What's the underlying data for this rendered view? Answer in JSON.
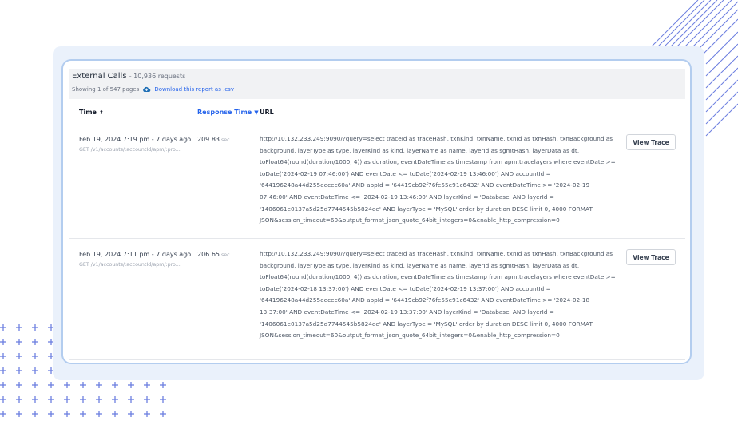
{
  "header": {
    "title": "External Calls",
    "count": "- 10,936 requests",
    "showing": "Showing 1 of 547 pages",
    "download_label": "Download this report as .csv",
    "download_icon": "cloud-download-icon"
  },
  "columns": {
    "time": "Time",
    "response_time": "Response Time",
    "url": "URL"
  },
  "rows": [
    {
      "time": "Feb 19, 2024 7:19 pm - 7 days ago",
      "endpoint": "GET /v1/accounts/:accountId/apm/:pro...",
      "response": "209.83",
      "unit": "sec",
      "url": "http://10.132.233.249:9090/?query=select traceId as traceHash, txnKind, txnName, txnId as txnHash, txnBackground as background, layerType as type, layerKind as kind, layerName as name, layerId as sgmtHash, layerData as dt, toFloat64(round(duration/1000, 4)) as duration, eventDateTime as timestamp from apm.tracelayers where eventDate >= toDate('2024-02-19 07:46:00') AND eventDate <= toDate('2024-02-19 13:46:00') AND accountId = '644196248a44d255eecec60a' AND appId = '64419cb92f76fe55e91c6432' AND eventDateTime >= '2024-02-19 07:46:00' AND eventDateTime <= '2024-02-19 13:46:00' AND layerKind = 'Database' AND layerId = '1406061e0137a5d25d7744545b5824ee' AND layerType = 'MySQL' order by duration DESC limit 0, 4000 FORMAT JSON&session_timeout=60&output_format_json_quote_64bit_integers=0&enable_http_compression=0",
      "button": "View Trace"
    },
    {
      "time": "Feb 19, 2024 7:11 pm - 7 days ago",
      "endpoint": "GET /v1/accounts/:accountId/apm/:pro...",
      "response": "206.65",
      "unit": "sec",
      "url": "http://10.132.233.249:9090/?query=select traceId as traceHash, txnKind, txnName, txnId as txnHash, txnBackground as background, layerType as type, layerKind as kind, layerName as name, layerId as sgmtHash, layerData as dt, toFloat64(round(duration/1000, 4)) as duration, eventDateTime as timestamp from apm.tracelayers where eventDate >= toDate('2024-02-18 13:37:00') AND eventDate <= toDate('2024-02-19 13:37:00') AND accountId = '644196248a44d255eecec60a' AND appId = '64419cb92f76fe55e91c6432' AND eventDateTime >= '2024-02-18 13:37:00' AND eventDateTime <= '2024-02-19 13:37:00' AND layerKind = 'Database' AND layerId = '1406061e0137a5d25d7744545b5824ee' AND layerType = 'MySQL' order by duration DESC limit 0, 4000 FORMAT JSON&session_timeout=60&output_format_json_quote_64bit_integers=0&enable_http_compression=0",
      "button": "View Trace"
    }
  ],
  "colors": {
    "accent": "#2563eb",
    "frame_border": "#b3cdef",
    "frame_bg": "#eaf1fb",
    "decor": "#6d7fe0"
  }
}
